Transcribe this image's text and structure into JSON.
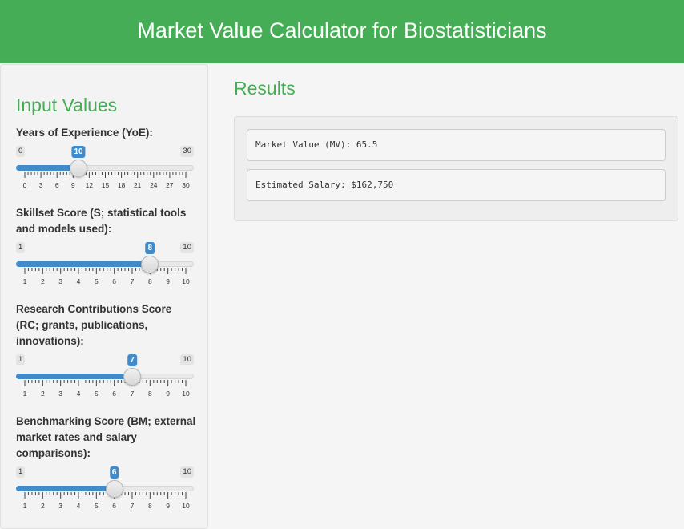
{
  "header": {
    "title": "Market Value Calculator for Biostatisticians",
    "bg_color": "#45ad55"
  },
  "sidebar": {
    "title": "Input Values",
    "sliders": [
      {
        "label": "Years of Experience (YoE):",
        "min": 0,
        "max": 30,
        "value": 10,
        "min_label": "0",
        "max_label": "30",
        "value_label": "10",
        "ticks": [
          "0",
          "3",
          "6",
          "9",
          "12",
          "15",
          "18",
          "21",
          "24",
          "27",
          "30"
        ]
      },
      {
        "label": "Skillset Score (S; statistical tools and models used):",
        "min": 1,
        "max": 10,
        "value": 8,
        "min_label": "1",
        "max_label": "10",
        "value_label": "8",
        "ticks": [
          "1",
          "2",
          "3",
          "4",
          "5",
          "6",
          "7",
          "8",
          "9",
          "10"
        ]
      },
      {
        "label": "Research Contributions Score (RC; grants, publications, innovations):",
        "min": 1,
        "max": 10,
        "value": 7,
        "min_label": "1",
        "max_label": "10",
        "value_label": "7",
        "ticks": [
          "1",
          "2",
          "3",
          "4",
          "5",
          "6",
          "7",
          "8",
          "9",
          "10"
        ]
      },
      {
        "label": "Benchmarking Score (BM; external market rates and salary comparisons):",
        "min": 1,
        "max": 10,
        "value": 6,
        "min_label": "1",
        "max_label": "10",
        "value_label": "6",
        "ticks": [
          "1",
          "2",
          "3",
          "4",
          "5",
          "6",
          "7",
          "8",
          "9",
          "10"
        ]
      }
    ]
  },
  "main": {
    "title": "Results",
    "market_value": "Market Value (MV): 65.5",
    "estimated_salary": "Estimated Salary: $162,750"
  },
  "colors": {
    "accent": "#45ad55",
    "slider_blue": "#428bca"
  }
}
